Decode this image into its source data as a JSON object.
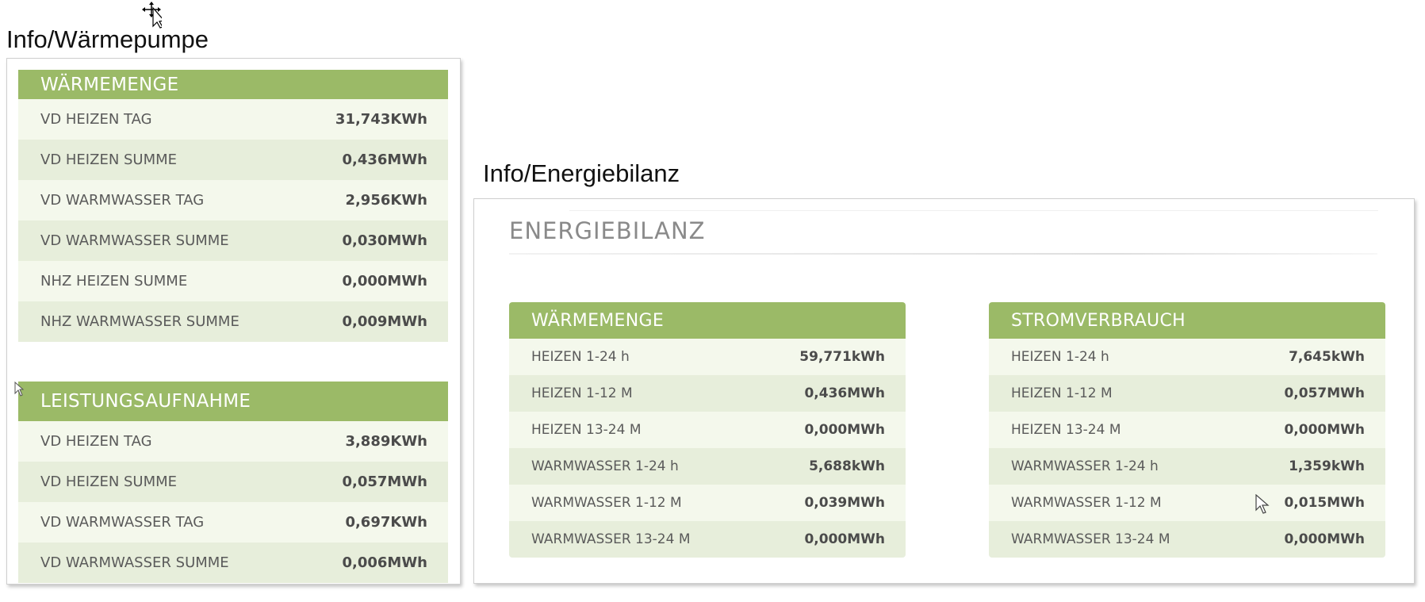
{
  "captions": {
    "left": "Info/Wärmepumpe",
    "right": "Info/Energiebilanz"
  },
  "waermepumpe": {
    "waermemenge": {
      "title": "WÄRMEMENGE",
      "rows": [
        {
          "label": "VD HEIZEN TAG",
          "value": "31,743KWh"
        },
        {
          "label": "VD HEIZEN SUMME",
          "value": "0,436MWh"
        },
        {
          "label": "VD WARMWASSER TAG",
          "value": "2,956KWh"
        },
        {
          "label": "VD WARMWASSER SUMME",
          "value": "0,030MWh"
        },
        {
          "label": "NHZ HEIZEN SUMME",
          "value": "0,000MWh"
        },
        {
          "label": "NHZ WARMWASSER SUMME",
          "value": "0,009MWh"
        }
      ]
    },
    "leistungsaufnahme": {
      "title": "LEISTUNGSAUFNAHME",
      "rows": [
        {
          "label": "VD HEIZEN TAG",
          "value": "3,889KWh"
        },
        {
          "label": "VD HEIZEN SUMME",
          "value": "0,057MWh"
        },
        {
          "label": "VD WARMWASSER TAG",
          "value": "0,697KWh"
        },
        {
          "label": "VD WARMWASSER SUMME",
          "value": "0,006MWh"
        }
      ]
    }
  },
  "energiebilanz": {
    "title": "ENERGIEBILANZ",
    "waermemenge": {
      "title": "WÄRMEMENGE",
      "rows": [
        {
          "label": "HEIZEN 1-24 h",
          "value": "59,771kWh"
        },
        {
          "label": "HEIZEN 1-12 M",
          "value": "0,436MWh"
        },
        {
          "label": "HEIZEN 13-24 M",
          "value": "0,000MWh"
        },
        {
          "label": "WARMWASSER 1-24 h",
          "value": "5,688kWh"
        },
        {
          "label": "WARMWASSER 1-12 M",
          "value": "0,039MWh"
        },
        {
          "label": "WARMWASSER 13-24 M",
          "value": "0,000MWh"
        }
      ]
    },
    "stromverbrauch": {
      "title": "STROMVERBRAUCH",
      "rows": [
        {
          "label": "HEIZEN 1-24 h",
          "value": "7,645kWh"
        },
        {
          "label": "HEIZEN 1-12 M",
          "value": "0,057MWh"
        },
        {
          "label": "HEIZEN 13-24 M",
          "value": "0,000MWh"
        },
        {
          "label": "WARMWASSER 1-24 h",
          "value": "1,359kWh"
        },
        {
          "label": "WARMWASSER 1-12 M",
          "value": "0,015MWh"
        },
        {
          "label": "WARMWASSER 13-24 M",
          "value": "0,000MWh"
        }
      ]
    }
  },
  "colors": {
    "header_green": "#9bba67",
    "row_light": "#f4f8ec",
    "row_dark": "#e7eedb"
  },
  "icons": {
    "move_cursor": "move-cursor-icon",
    "arrow_cursor": "arrow-cursor-icon"
  }
}
